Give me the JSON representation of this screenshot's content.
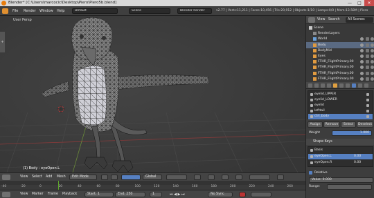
{
  "window": {
    "title": "Blender* [C:\\Users\\marcocic\\Desktop\\Piero\\Piero5b.blend]",
    "minimize": "—",
    "maximize": "□",
    "close": "✕"
  },
  "menubar": {
    "items": [
      "File",
      "Render",
      "Window",
      "Help"
    ],
    "layout": "Default",
    "scene": "Scene",
    "engine": "Blender Render",
    "version": "v2.77",
    "stats": "Verts:11,211 | Faces:10,456 | Tris:20,912 | Objects:1/10 | Lamps:0/0 | Mem:13.58M | Piero"
  },
  "viewport": {
    "label": "User Persp",
    "object_info": "(1) Body : eyeOpen.L"
  },
  "viewport_header": {
    "view": "View",
    "select": "Select",
    "add": "Add",
    "mesh": "Mesh",
    "mode": "Edit Mode",
    "pivot": "Global"
  },
  "timeline": {
    "ticks": [
      "-40",
      "-20",
      "0",
      "20",
      "40",
      "60",
      "80",
      "100",
      "120",
      "140",
      "160",
      "180",
      "200",
      "220",
      "240",
      "260"
    ],
    "menu": [
      "View",
      "Marker",
      "Frame",
      "Playback"
    ],
    "start_label": "Start:",
    "start_value": "1",
    "end_label": "End:",
    "end_value": "250",
    "current": "1",
    "sync": "No Sync"
  },
  "outliner": {
    "view": "View",
    "search": "Search",
    "filter": "All Scenes",
    "rows": [
      {
        "label": "Scene",
        "indent": 0,
        "selected": false
      },
      {
        "label": "RenderLayers",
        "indent": 1,
        "selected": false
      },
      {
        "label": "World",
        "indent": 1,
        "selected": false
      },
      {
        "label": "Body",
        "indent": 1,
        "selected": true
      },
      {
        "label": "BodyMid",
        "indent": 1,
        "selected": false
      },
      {
        "label": "Eyes",
        "indent": 1,
        "selected": false
      },
      {
        "label": "FTHR_FlightPrimary.00",
        "indent": 1,
        "selected": false
      },
      {
        "label": "FTHR_FlightPrimary.00",
        "indent": 1,
        "selected": false
      },
      {
        "label": "FTHR_FlightPrimary.00",
        "indent": 1,
        "selected": false
      },
      {
        "label": "FTHR_FlightPrimary.00",
        "indent": 1,
        "selected": false
      }
    ]
  },
  "properties": {
    "vertex_groups": [
      "eyelid_UPPER",
      "eyelid_LOWER",
      "eyelid",
      "lefttail",
      "ctrl_body"
    ],
    "vg_selected_index": 4,
    "buttons": [
      "Assign",
      "Remove",
      "Select",
      "Deselect"
    ],
    "weight_label": "Weight",
    "weight_value": "1.000",
    "shape_keys_label": "Shape Keys",
    "shape_keys": [
      {
        "name": "Basis",
        "value": "",
        "selected": false
      },
      {
        "name": "eyeOpen.L",
        "value": "0.00",
        "selected": true
      },
      {
        "name": "eyeOpen.R",
        "value": "0.00",
        "selected": false
      }
    ],
    "relative_label": "Relative",
    "value_label": "Value:",
    "value": "0.000",
    "range_label": "Range:"
  }
}
